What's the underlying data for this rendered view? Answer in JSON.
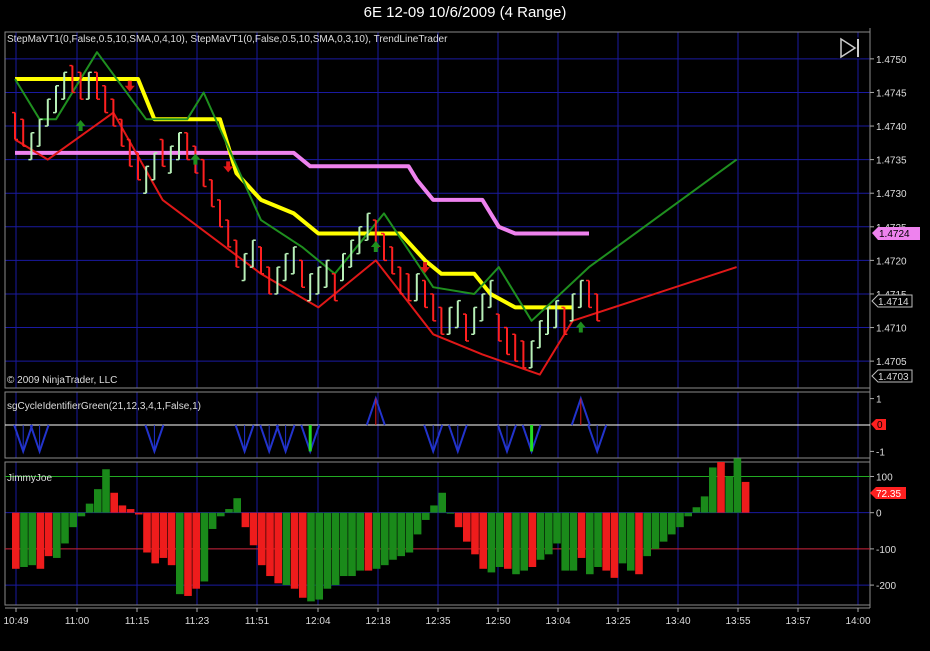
{
  "window": {
    "title": "6E 12-09  10/6/2009 (4 Range)"
  },
  "main_panel": {
    "indicators_label": "StepMaVT1(0,False,0.5,10,SMA,0,4,10), StepMaVT1(0,False,0.5,10,SMA,0,3,10), TrendLineTrader",
    "copyright": "© 2009 NinjaTrader, LLC",
    "badges": {
      "pink": "1.4724",
      "last": "1.4714",
      "low": "1.4703"
    },
    "play_icon": "play-pause-icon"
  },
  "cycle_panel": {
    "label": "sgCycleIdentifierGreen(21,12,3,4,1,False,1)",
    "badge": "0"
  },
  "jimmy_panel": {
    "label": "JimmyJoe",
    "badge": "72.35"
  },
  "colors": {
    "background": "#000000",
    "grid": "#1a1aa0",
    "up": "#b8f0b8",
    "down": "#ff2020",
    "yellow": "#ffff00",
    "pink": "#ee82ee",
    "green_line": "#1f8f1f",
    "red_line": "#e01818"
  },
  "chart_data": [
    {
      "type": "candlestick",
      "name": "price",
      "ylim": [
        1.4701,
        1.4754
      ],
      "yticks": [
        "1.4750",
        "1.4745",
        "1.4740",
        "1.4735",
        "1.4730",
        "1.4725",
        "1.4720",
        "1.4715",
        "1.4710",
        "1.4705"
      ],
      "xticks": [
        "10:49",
        "11:00",
        "11:15",
        "11:23",
        "11:51",
        "12:04",
        "12:18",
        "12:35",
        "12:50",
        "13:04",
        "13:25",
        "13:40",
        "13:55",
        "13:57",
        "14:00"
      ],
      "bars": [
        [
          "d",
          1.4742,
          1.4738
        ],
        [
          "d",
          1.4741,
          1.4737
        ],
        [
          "u",
          1.4735,
          1.4739
        ],
        [
          "u",
          1.4737,
          1.4741
        ],
        [
          "u",
          1.474,
          1.4744
        ],
        [
          "u",
          1.4742,
          1.4746
        ],
        [
          "u",
          1.4744,
          1.4748
        ],
        [
          "d",
          1.4749,
          1.4745
        ],
        [
          "d",
          1.4748,
          1.4744
        ],
        [
          "u",
          1.4744,
          1.4748
        ],
        [
          "d",
          1.4748,
          1.4744
        ],
        [
          "d",
          1.4746,
          1.4742
        ],
        [
          "d",
          1.4744,
          1.474
        ],
        [
          "d",
          1.4741,
          1.4737
        ],
        [
          "d",
          1.4738,
          1.4734
        ],
        [
          "d",
          1.4736,
          1.4732
        ],
        [
          "u",
          1.473,
          1.4734
        ],
        [
          "u",
          1.4732,
          1.4736
        ],
        [
          "d",
          1.4738,
          1.4734
        ],
        [
          "u",
          1.4733,
          1.4737
        ],
        [
          "u",
          1.4735,
          1.4739
        ],
        [
          "d",
          1.4739,
          1.4735
        ],
        [
          "d",
          1.4737,
          1.4733
        ],
        [
          "d",
          1.4735,
          1.4731
        ],
        [
          "d",
          1.4732,
          1.4728
        ],
        [
          "d",
          1.4729,
          1.4725
        ],
        [
          "d",
          1.4726,
          1.4722
        ],
        [
          "d",
          1.4723,
          1.4719
        ],
        [
          "u",
          1.4717,
          1.4721
        ],
        [
          "u",
          1.4719,
          1.4723
        ],
        [
          "d",
          1.4722,
          1.4718
        ],
        [
          "d",
          1.4719,
          1.4715
        ],
        [
          "u",
          1.4715,
          1.4719
        ],
        [
          "u",
          1.4717,
          1.4721
        ],
        [
          "u",
          1.4718,
          1.4722
        ],
        [
          "d",
          1.472,
          1.4716
        ],
        [
          "u",
          1.4714,
          1.4718
        ],
        [
          "u",
          1.4715,
          1.4719
        ],
        [
          "u",
          1.4716,
          1.472
        ],
        [
          "d",
          1.4718,
          1.4714
        ],
        [
          "u",
          1.4717,
          1.4721
        ],
        [
          "u",
          1.4719,
          1.4723
        ],
        [
          "u",
          1.4721,
          1.4725
        ],
        [
          "u",
          1.4723,
          1.4727
        ],
        [
          "d",
          1.4726,
          1.4722
        ],
        [
          "d",
          1.4724,
          1.472
        ],
        [
          "d",
          1.4722,
          1.4718
        ],
        [
          "d",
          1.4719,
          1.4715
        ],
        [
          "d",
          1.4718,
          1.4714
        ],
        [
          "u",
          1.4714,
          1.4718
        ],
        [
          "d",
          1.4717,
          1.4713
        ],
        [
          "d",
          1.4715,
          1.4711
        ],
        [
          "d",
          1.4713,
          1.4709
        ],
        [
          "u",
          1.4709,
          1.4713
        ],
        [
          "u",
          1.471,
          1.4714
        ],
        [
          "d",
          1.4712,
          1.4708
        ],
        [
          "u",
          1.4709,
          1.4713
        ],
        [
          "u",
          1.4711,
          1.4715
        ],
        [
          "u",
          1.4713,
          1.4717
        ],
        [
          "d",
          1.4712,
          1.4708
        ],
        [
          "d",
          1.471,
          1.4706
        ],
        [
          "d",
          1.4709,
          1.4705
        ],
        [
          "d",
          1.4708,
          1.4704
        ],
        [
          "u",
          1.4704,
          1.4708
        ],
        [
          "u",
          1.4707,
          1.4711
        ],
        [
          "u",
          1.4709,
          1.4713
        ],
        [
          "u",
          1.471,
          1.4714
        ],
        [
          "d",
          1.4713,
          1.4709
        ],
        [
          "u",
          1.4711,
          1.4715
        ],
        [
          "u",
          1.4713,
          1.4717
        ],
        [
          "d",
          1.4717,
          1.4713
        ],
        [
          "d",
          1.4715,
          1.4711
        ]
      ],
      "lines": {
        "yellow": [
          [
            0,
            1.4747
          ],
          [
            4,
            1.4747
          ],
          [
            15,
            1.4747
          ],
          [
            17,
            1.4741
          ],
          [
            25,
            1.4741
          ],
          [
            27,
            1.4733
          ],
          [
            30,
            1.4729
          ],
          [
            34,
            1.4727
          ],
          [
            37,
            1.4724
          ],
          [
            43,
            1.4724
          ],
          [
            47,
            1.4724
          ],
          [
            50,
            1.472
          ],
          [
            52,
            1.4718
          ],
          [
            56,
            1.4718
          ],
          [
            58,
            1.4715
          ],
          [
            61,
            1.4713
          ],
          [
            68,
            1.4713
          ]
        ],
        "pink": [
          [
            0,
            1.4736
          ],
          [
            34,
            1.4736
          ],
          [
            36,
            1.4734
          ],
          [
            48,
            1.4734
          ],
          [
            49,
            1.4732
          ],
          [
            51,
            1.4729
          ],
          [
            57,
            1.4729
          ],
          [
            59,
            1.4725
          ],
          [
            61,
            1.4724
          ],
          [
            70,
            1.4724
          ]
        ],
        "green": [
          [
            0,
            1.4747
          ],
          [
            3,
            1.4741
          ],
          [
            5,
            1.4741
          ],
          [
            10,
            1.4751
          ],
          [
            16,
            1.4741
          ],
          [
            21,
            1.4741
          ],
          [
            23,
            1.4745
          ],
          [
            30,
            1.4726
          ],
          [
            35,
            1.4722
          ],
          [
            39,
            1.4718
          ],
          [
            45,
            1.4727
          ],
          [
            51,
            1.4716
          ],
          [
            56,
            1.4715
          ],
          [
            59,
            1.4719
          ],
          [
            63,
            1.4711
          ],
          [
            70,
            1.4719
          ],
          [
            88,
            1.4735
          ]
        ],
        "red": [
          [
            0,
            1.4738
          ],
          [
            4,
            1.4735
          ],
          [
            12,
            1.4742
          ],
          [
            18,
            1.4729
          ],
          [
            30,
            1.4718
          ],
          [
            37,
            1.4713
          ],
          [
            44,
            1.472
          ],
          [
            51,
            1.4709
          ],
          [
            57,
            1.4706
          ],
          [
            64,
            1.4703
          ],
          [
            68,
            1.4711
          ],
          [
            88,
            1.4719
          ]
        ]
      },
      "arrows": [
        {
          "bar": 8,
          "dir": "up",
          "price": 1.474
        },
        {
          "bar": 14,
          "dir": "down",
          "price": 1.4746
        },
        {
          "bar": 22,
          "dir": "up",
          "price": 1.4735
        },
        {
          "bar": 26,
          "dir": "down",
          "price": 1.4734
        },
        {
          "bar": 44,
          "dir": "up",
          "price": 1.4722
        },
        {
          "bar": 50,
          "dir": "down",
          "price": 1.4719
        },
        {
          "bar": 69,
          "dir": "up",
          "price": 1.471
        }
      ]
    },
    {
      "type": "line",
      "name": "sgCycleIdentifierGreen",
      "ylim": [
        -1.25,
        1.25
      ],
      "yticks": [
        "1",
        "-1"
      ],
      "marks": [
        {
          "bar": 1,
          "dir": "down"
        },
        {
          "bar": 3,
          "dir": "down"
        },
        {
          "bar": 17,
          "dir": "down"
        },
        {
          "bar": 28,
          "dir": "down"
        },
        {
          "bar": 31,
          "dir": "down"
        },
        {
          "bar": 33,
          "dir": "down"
        },
        {
          "bar": 36,
          "dir": "down",
          "green": true
        },
        {
          "bar": 44,
          "dir": "up"
        },
        {
          "bar": 51,
          "dir": "down"
        },
        {
          "bar": 54,
          "dir": "down"
        },
        {
          "bar": 60,
          "dir": "down"
        },
        {
          "bar": 63,
          "dir": "down",
          "green": true
        },
        {
          "bar": 69,
          "dir": "up"
        },
        {
          "bar": 71,
          "dir": "down"
        }
      ]
    },
    {
      "type": "bar",
      "name": "JimmyJoe",
      "ylim": [
        -255,
        140
      ],
      "yticks": [
        "100",
        "0",
        "-100",
        "-200"
      ],
      "reference_lines": [
        100,
        -100
      ],
      "values": [
        [
          -155,
          "r"
        ],
        [
          -150,
          "g"
        ],
        [
          -145,
          "g"
        ],
        [
          -155,
          "r"
        ],
        [
          -120,
          "r"
        ],
        [
          -125,
          "g"
        ],
        [
          -85,
          "g"
        ],
        [
          -40,
          "g"
        ],
        [
          -10,
          "g"
        ],
        [
          25,
          "g"
        ],
        [
          65,
          "g"
        ],
        [
          120,
          "g"
        ],
        [
          55,
          "r"
        ],
        [
          20,
          "r"
        ],
        [
          10,
          "r"
        ],
        [
          -5,
          "r"
        ],
        [
          -110,
          "r"
        ],
        [
          -140,
          "r"
        ],
        [
          -125,
          "r"
        ],
        [
          -145,
          "r"
        ],
        [
          -225,
          "g"
        ],
        [
          -230,
          "r"
        ],
        [
          -210,
          "r"
        ],
        [
          -190,
          "g"
        ],
        [
          -45,
          "g"
        ],
        [
          -10,
          "g"
        ],
        [
          10,
          "g"
        ],
        [
          40,
          "g"
        ],
        [
          -40,
          "r"
        ],
        [
          -90,
          "r"
        ],
        [
          -145,
          "r"
        ],
        [
          -175,
          "r"
        ],
        [
          -195,
          "r"
        ],
        [
          -200,
          "g"
        ],
        [
          -210,
          "r"
        ],
        [
          -235,
          "r"
        ],
        [
          -245,
          "g"
        ],
        [
          -240,
          "g"
        ],
        [
          -210,
          "g"
        ],
        [
          -200,
          "g"
        ],
        [
          -175,
          "g"
        ],
        [
          -175,
          "g"
        ],
        [
          -160,
          "g"
        ],
        [
          -160,
          "r"
        ],
        [
          -155,
          "g"
        ],
        [
          -145,
          "g"
        ],
        [
          -130,
          "g"
        ],
        [
          -120,
          "g"
        ],
        [
          -110,
          "g"
        ],
        [
          -60,
          "g"
        ],
        [
          -20,
          "g"
        ],
        [
          20,
          "g"
        ],
        [
          55,
          "g"
        ],
        [
          0,
          "g"
        ],
        [
          -40,
          "r"
        ],
        [
          -80,
          "r"
        ],
        [
          -115,
          "r"
        ],
        [
          -155,
          "r"
        ],
        [
          -165,
          "g"
        ],
        [
          -150,
          "g"
        ],
        [
          -155,
          "r"
        ],
        [
          -170,
          "g"
        ],
        [
          -160,
          "g"
        ],
        [
          -150,
          "r"
        ],
        [
          -130,
          "g"
        ],
        [
          -115,
          "g"
        ],
        [
          -85,
          "g"
        ],
        [
          -160,
          "g"
        ],
        [
          -160,
          "g"
        ],
        [
          -125,
          "r"
        ],
        [
          -170,
          "g"
        ],
        [
          -150,
          "g"
        ],
        [
          -160,
          "r"
        ],
        [
          -180,
          "r"
        ],
        [
          -140,
          "g"
        ],
        [
          -160,
          "g"
        ],
        [
          -170,
          "r"
        ],
        [
          -120,
          "g"
        ],
        [
          -100,
          "g"
        ],
        [
          -80,
          "g"
        ],
        [
          -60,
          "g"
        ],
        [
          -40,
          "g"
        ],
        [
          -10,
          "g"
        ],
        [
          15,
          "g"
        ],
        [
          45,
          "g"
        ],
        [
          125,
          "g"
        ],
        [
          140,
          "r"
        ],
        [
          100,
          "g"
        ],
        [
          150,
          "g"
        ],
        [
          85,
          "r"
        ]
      ]
    }
  ]
}
